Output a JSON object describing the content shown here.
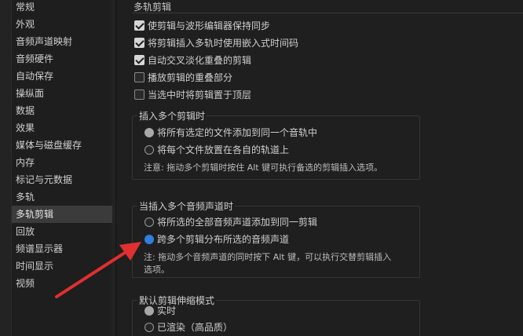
{
  "sidebar": {
    "items": [
      {
        "label": "常规"
      },
      {
        "label": "外观"
      },
      {
        "label": "音频声道映射"
      },
      {
        "label": "音频硬件"
      },
      {
        "label": "自动保存"
      },
      {
        "label": "操纵面"
      },
      {
        "label": "数据"
      },
      {
        "label": "效果"
      },
      {
        "label": "媒体与磁盘缓存"
      },
      {
        "label": "内存"
      },
      {
        "label": "标记与元数据"
      },
      {
        "label": "多轨"
      },
      {
        "label": "多轨剪辑",
        "active": true
      },
      {
        "label": "回放"
      },
      {
        "label": "频谱显示器"
      },
      {
        "label": "时间显示"
      },
      {
        "label": "视频"
      }
    ]
  },
  "main": {
    "section_title": "多轨剪辑",
    "checkboxes": [
      {
        "label": "使剪辑与波形编辑器保持同步",
        "checked": true
      },
      {
        "label": "将剪辑插入多轨时使用嵌入式时间码",
        "checked": true
      },
      {
        "label": "自动交叉淡化重叠的剪辑",
        "checked": true
      },
      {
        "label": "播放剪辑的重叠部分",
        "checked": false
      },
      {
        "label": "当选中时将剪辑置于顶层",
        "checked": false
      }
    ],
    "insert_multiple": {
      "title": "插入多个剪辑时",
      "options": [
        {
          "label": "将所有选定的文件添加到同一个音轨中",
          "selected": true
        },
        {
          "label": "将每个文件放置在各自的轨道上",
          "selected": false
        }
      ],
      "note": "注意: 拖动多个剪辑时按住 Alt 键可执行备选的剪辑插入选项。"
    },
    "insert_channels": {
      "title": "当插入多个音频声道时",
      "options": [
        {
          "label": "将所选的全部音频声道添加到同一剪辑",
          "selected": false
        },
        {
          "label": "跨多个剪辑分布所选的音频声道",
          "selected": true
        }
      ],
      "note_line1": "注: 拖动多个音频声道的同时按下 Alt 键，可以执行交替剪辑插入",
      "note_line2": "选项。"
    },
    "stretch_mode": {
      "title": "默认剪辑伸缩模式",
      "options": [
        {
          "label": "实时",
          "selected": true
        },
        {
          "label": "已渲染（高品质）",
          "selected": false
        }
      ]
    }
  },
  "colors": {
    "accent": "#2f7fe0",
    "annotation_arrow": "#e03030",
    "background": "#1f1f1f"
  }
}
